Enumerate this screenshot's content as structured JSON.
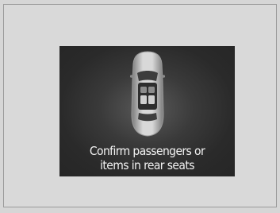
{
  "message": {
    "line1": "Confirm passengers or",
    "line2": "items in rear seats"
  },
  "icons": {
    "car": "car-top-view-icon",
    "rear_seats": "rear-seats-icon"
  },
  "colors": {
    "background": "#d6d6d6",
    "display_background": "#2a2a2a",
    "text": "#f2f2f2"
  }
}
